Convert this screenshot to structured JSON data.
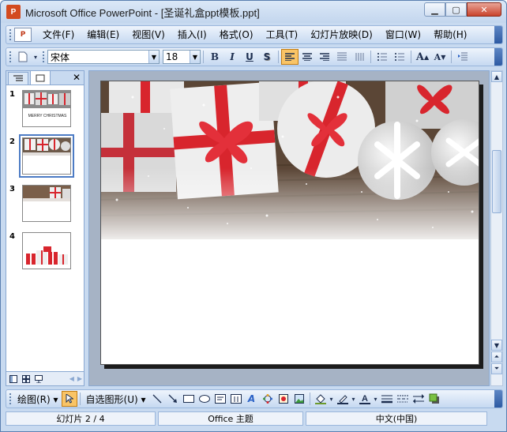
{
  "window": {
    "app_title": "Microsoft Office PowerPoint",
    "separator": " - ",
    "document_title": "[圣诞礼盒ppt模板.ppt]",
    "app_icon_letter": "P"
  },
  "menu": {
    "items": [
      "文件(F)",
      "编辑(E)",
      "视图(V)",
      "插入(I)",
      "格式(O)",
      "工具(T)",
      "幻灯片放映(D)",
      "窗口(W)",
      "帮助(H)"
    ]
  },
  "format_toolbar": {
    "font_name": "宋体",
    "font_size": "18",
    "bold": "B",
    "italic": "I",
    "underline": "U",
    "shadow": "S",
    "align_left_active": true
  },
  "slides_panel": {
    "tabs": [
      "outline",
      "slides"
    ],
    "slide_numbers": [
      "1",
      "2",
      "3",
      "4"
    ],
    "selected_slide": 2,
    "thumb1_caption": "MERRY CHRISTMAS"
  },
  "draw_toolbar": {
    "draw_label": "绘图(R)",
    "autoshapes_label": "自选图形(U)"
  },
  "status": {
    "slide_info": "幻灯片 2 / 4",
    "theme": "Office 主题",
    "language": "中文(中国)"
  },
  "colors": {
    "ribbon_red": "#d8252d",
    "title_bar": "#c3d6ee",
    "stage_bg": "#a6b3c5",
    "active_button": "#f9c466"
  }
}
